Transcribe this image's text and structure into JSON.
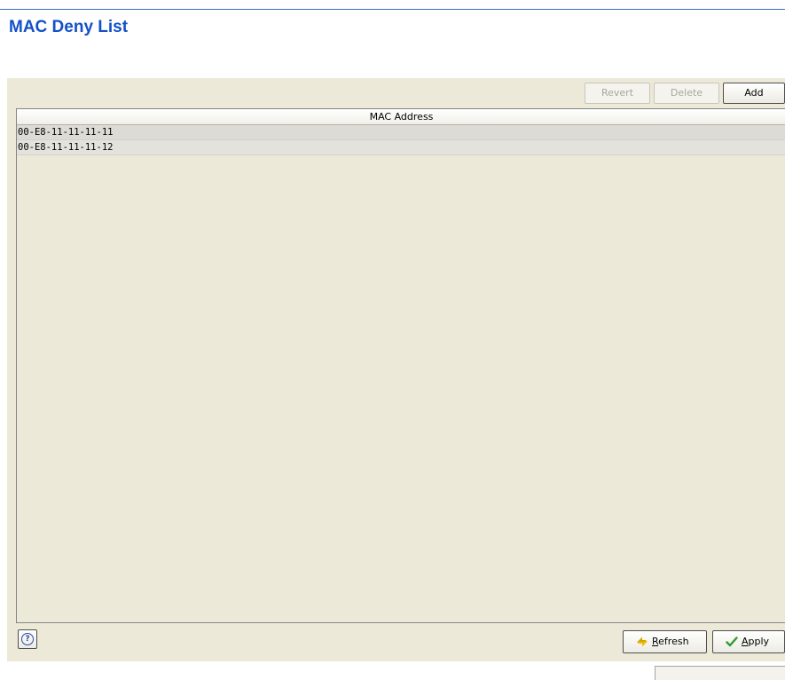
{
  "page": {
    "title": "MAC Deny List"
  },
  "toolbar": {
    "revert_label": "Revert",
    "delete_label": "Delete",
    "add_label": "Add"
  },
  "table": {
    "columns": [
      "MAC Address"
    ],
    "rows": [
      "00-E8-11-11-11-11",
      "00-E8-11-11-11-12"
    ]
  },
  "footer": {
    "help_glyph": "?",
    "refresh_label": "Refresh",
    "apply_label": "Apply"
  },
  "colors": {
    "title": "#1450c8",
    "panel_bg": "#ece9d8",
    "row_bg": "#dcdbd6",
    "accent_line": "#3b6bc6"
  },
  "icons": {
    "help": "help-icon",
    "refresh": "refresh-icon",
    "apply": "checkmark-icon"
  }
}
